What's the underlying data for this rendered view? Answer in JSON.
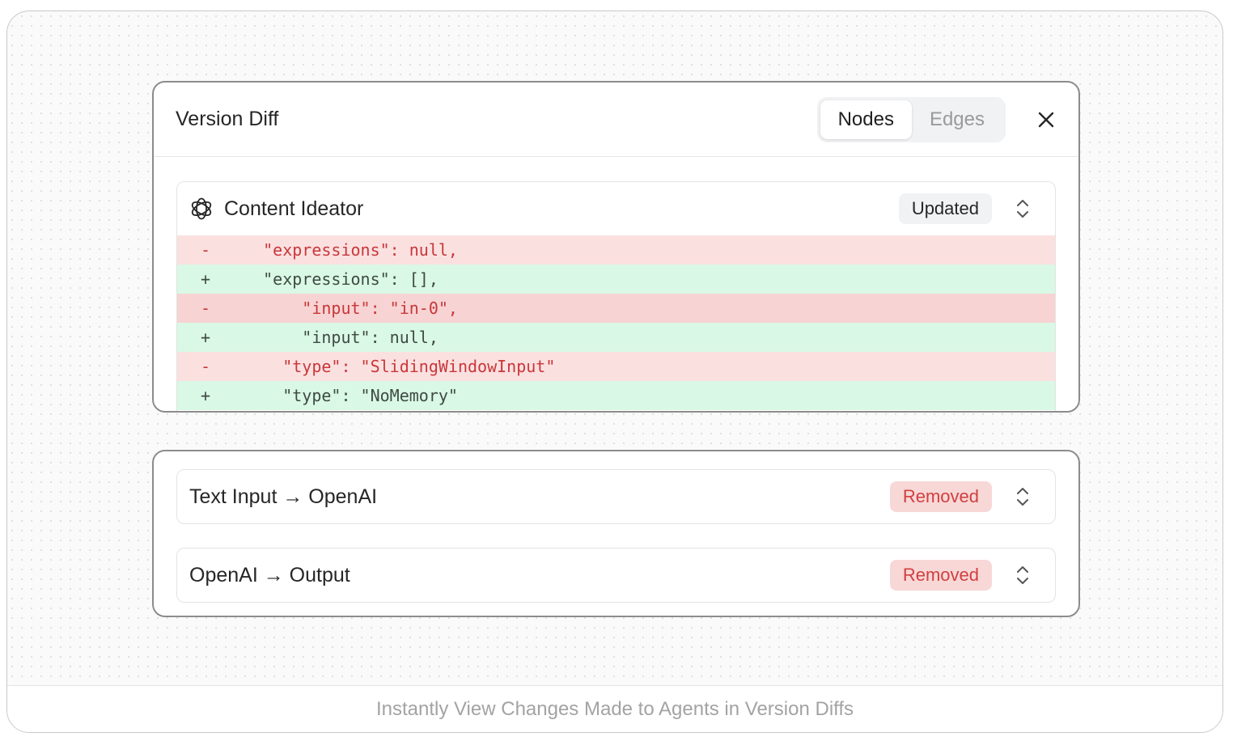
{
  "panel": {
    "title": "Version Diff",
    "tabs": [
      {
        "label": "Nodes",
        "active": true
      },
      {
        "label": "Edges",
        "active": false
      }
    ],
    "close_icon": "close-icon"
  },
  "node_card": {
    "icon": "openai-logo-icon",
    "title": "Content Ideator",
    "status": "Updated",
    "expand_icon": "chevron-up-down-icon",
    "diff_lines": [
      {
        "sign": "-",
        "kind": "del",
        "text": "   \"expressions\": null,"
      },
      {
        "sign": "+",
        "kind": "add",
        "text": "   \"expressions\": [],"
      },
      {
        "sign": "-",
        "kind": "del",
        "text": "       \"input\": \"in-0\","
      },
      {
        "sign": "+",
        "kind": "add",
        "text": "       \"input\": null,"
      },
      {
        "sign": "-",
        "kind": "del",
        "text": "     \"type\": \"SlidingWindowInput\""
      },
      {
        "sign": "+",
        "kind": "add",
        "text": "     \"type\": \"NoMemory\""
      }
    ]
  },
  "edges": [
    {
      "title": "Text Input → OpenAI",
      "status": "Removed"
    },
    {
      "title": "OpenAI → Output",
      "status": "Removed"
    }
  ],
  "caption": "Instantly View Changes Made to Agents in Version Diffs",
  "colors": {
    "deleted_bg": "#fbe0e0",
    "added_bg": "#d9f8e5",
    "removed_badge": "#f8d7d7",
    "removed_text": "#d0403f"
  }
}
